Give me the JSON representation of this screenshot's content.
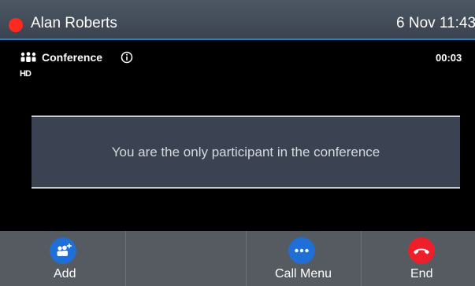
{
  "status_bar": {
    "user_name": "Alan Roberts",
    "datetime": "6 Nov 11:43"
  },
  "call": {
    "type_label": "Conference",
    "hd_badge": "HD",
    "timer": "00:03",
    "message": "You are the only participant in the conference"
  },
  "softkeys": [
    {
      "label": "Add",
      "icon": "add-participant-icon",
      "color": "#1f6fd6"
    },
    {
      "label": "",
      "icon": "",
      "color": ""
    },
    {
      "label": "",
      "icon": "",
      "color": ""
    },
    {
      "label": "Call Menu",
      "icon": "more-icon",
      "color": "#1f6fd6"
    },
    {
      "label": "End",
      "icon": "end-call-icon",
      "color": "#ee1f2b"
    }
  ],
  "colors": {
    "recording_dot": "#ff2a1f",
    "accent_blue": "#1f6fd6",
    "end_red": "#ee1f2b"
  }
}
